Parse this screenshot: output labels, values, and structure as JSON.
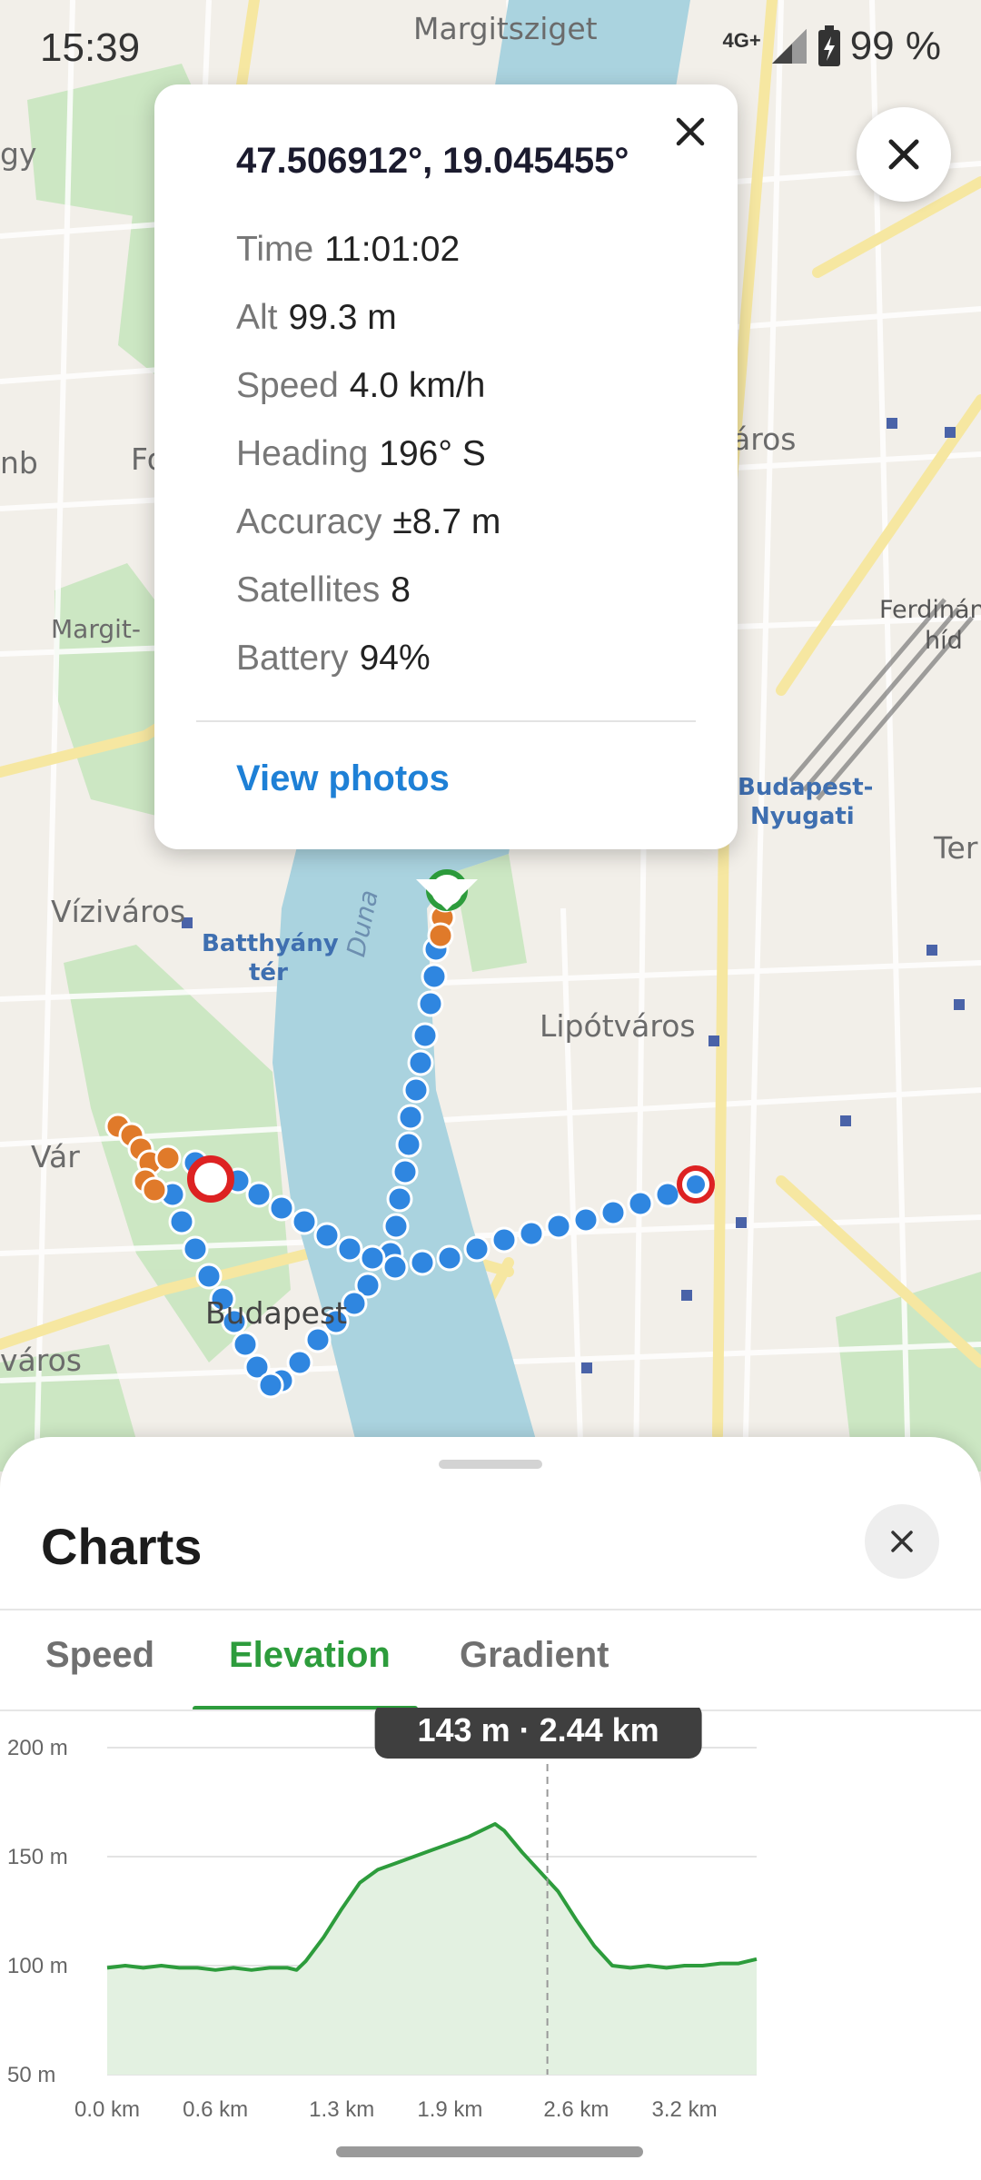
{
  "status_bar": {
    "time": "15:39",
    "network": "4G+",
    "battery": "99 %"
  },
  "map": {
    "labels": {
      "margitsziget": "Margitsziget",
      "margit": "Margit-",
      "vizivaros": "Víziváros",
      "var": "Vár",
      "budapest": "Budapest",
      "varos": "város",
      "lipotvaros": "Lipótváros",
      "batthyany_1": "Batthyány",
      "batthyany_2": "tér",
      "nyugati_1": "Budapest-",
      "nyugati_2": "Nyugati",
      "ferdinand_1": "Ferdinán",
      "ferdinand_2": "híd",
      "duna": "Duna",
      "varos_right": "áros",
      "gy": "gy",
      "nb": "nb",
      "fo": "Fo",
      "ter": "Ter"
    }
  },
  "popup": {
    "coords": "47.506912°, 19.045455°",
    "rows": [
      {
        "label": "Time",
        "value": "11:01:02"
      },
      {
        "label": "Alt",
        "value": "99.3 m"
      },
      {
        "label": "Speed",
        "value": "4.0 km/h"
      },
      {
        "label": "Heading",
        "value": "196° S"
      },
      {
        "label": "Accuracy",
        "value": "±8.7 m"
      },
      {
        "label": "Satellites",
        "value": "8"
      },
      {
        "label": "Battery",
        "value": "94%"
      }
    ],
    "view_photos": "View photos"
  },
  "sheet": {
    "title": "Charts",
    "tabs": [
      {
        "label": "Speed",
        "active": false
      },
      {
        "label": "Elevation",
        "active": true
      },
      {
        "label": "Gradient",
        "active": false
      }
    ]
  },
  "colors": {
    "accent": "#2d9c3c",
    "link": "#1e80d6",
    "track": "#2f86e0",
    "track_alt": "#e07a2a"
  },
  "chart_data": {
    "type": "area",
    "ylabel_unit": "m",
    "xlabel_unit": "km",
    "ylim": [
      50,
      200
    ],
    "xlim": [
      0.0,
      3.6
    ],
    "y_ticks": [
      "200 m",
      "150 m",
      "100 m",
      "50 m"
    ],
    "y_tick_values": [
      200,
      150,
      100,
      50
    ],
    "x_ticks": [
      "0.0 km",
      "0.6 km",
      "1.3 km",
      "1.9 km",
      "2.6 km",
      "3.2 km"
    ],
    "x_tick_values": [
      0.0,
      0.6,
      1.3,
      1.9,
      2.6,
      3.2
    ],
    "tooltip": "143 m · 2.44 km",
    "cursor_x": 2.44,
    "grid": true,
    "series": [
      {
        "x": [
          0.0,
          0.1,
          0.2,
          0.3,
          0.4,
          0.5,
          0.6,
          0.7,
          0.8,
          0.9,
          1.0,
          1.05,
          1.1,
          1.2,
          1.3,
          1.4,
          1.5,
          1.6,
          1.7,
          1.8,
          1.9,
          2.0,
          2.1,
          2.15,
          2.2,
          2.3,
          2.4,
          2.5,
          2.6,
          2.7,
          2.8,
          2.9,
          3.0,
          3.1,
          3.2,
          3.3,
          3.4,
          3.5,
          3.6
        ],
        "y": [
          99,
          100,
          99,
          100,
          99,
          99,
          98,
          99,
          98,
          99,
          99,
          98,
          102,
          113,
          126,
          138,
          144,
          147,
          150,
          153,
          156,
          159,
          163,
          165,
          162,
          152,
          143,
          134,
          121,
          109,
          100,
          99,
          100,
          99,
          100,
          100,
          101,
          101,
          103
        ]
      }
    ]
  }
}
